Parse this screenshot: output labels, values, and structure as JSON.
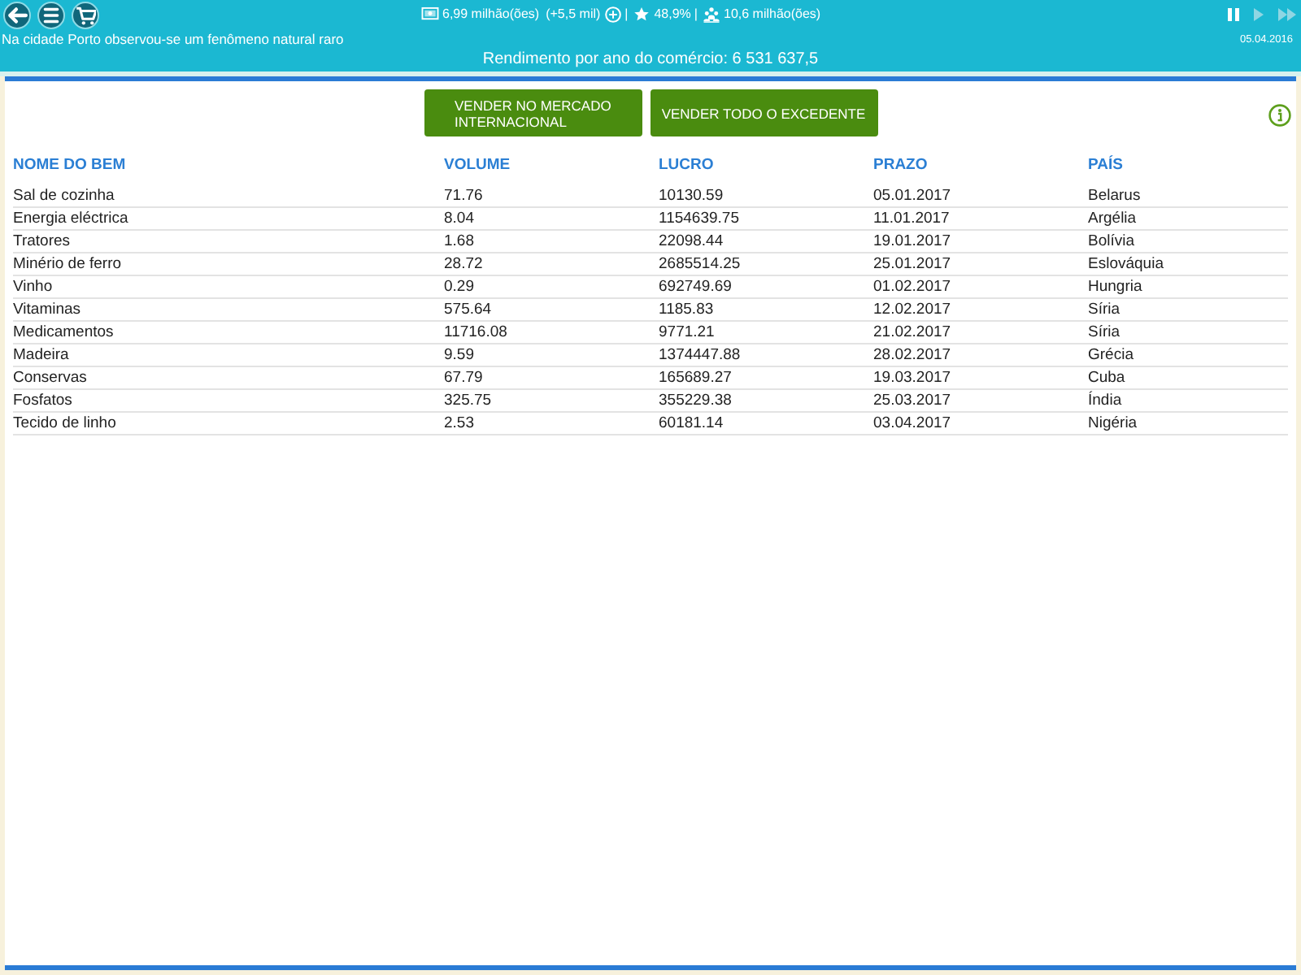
{
  "toolbar": {
    "stats": [
      {
        "kind": "treasury",
        "value": "6,99 milhão(ões)",
        "change": "(+5,5 mil)"
      },
      {
        "kind": "separator",
        "value": "|"
      },
      {
        "kind": "rating",
        "value": "48,9%"
      },
      {
        "kind": "separator",
        "value": "|"
      },
      {
        "kind": "population",
        "value": "10,6 milhão(ões)"
      }
    ],
    "speed_controls": [
      {
        "kind": "pause",
        "selected": true
      },
      {
        "kind": "play",
        "selected": false
      },
      {
        "kind": "fast_forward",
        "selected": false
      }
    ]
  },
  "news": "Na cidade Porto observou-se um fenômeno natural raro",
  "date": "05.04.2016",
  "trade_income": "Rendimento por ano do comércio: 6 531 637,5",
  "actions": [
    "VENDER NO MERCADO INTERNACIONAL",
    "VENDER TODO O EXCEDENTE"
  ],
  "table": {
    "columns": [
      "NOME DO BEM",
      "VOLUME",
      "LUCRO",
      "PRAZO",
      "PAÍS"
    ],
    "rows": [
      [
        "Sal de cozinha",
        "71.76",
        "10130.59",
        "05.01.2017",
        "Belarus"
      ],
      [
        "Energia eléctrica",
        "8.04",
        "1154639.75",
        "11.01.2017",
        "Argélia"
      ],
      [
        "Tratores",
        "1.68",
        "22098.44",
        "19.01.2017",
        "Bolívia"
      ],
      [
        "Minério de ferro",
        "28.72",
        "2685514.25",
        "25.01.2017",
        "Eslováquia"
      ],
      [
        "Vinho",
        "0.29",
        "692749.69",
        "01.02.2017",
        "Hungria"
      ],
      [
        "Vitaminas",
        "575.64",
        "1185.83",
        "12.02.2017",
        "Síria"
      ],
      [
        "Medicamentos",
        "11716.08",
        "9771.21",
        "21.02.2017",
        "Síria"
      ],
      [
        "Madeira",
        "9.59",
        "1374447.88",
        "28.02.2017",
        "Grécia"
      ],
      [
        "Conservas",
        "67.79",
        "165689.27",
        "19.03.2017",
        "Cuba"
      ],
      [
        "Fosfatos",
        "325.75",
        "355229.38",
        "25.03.2017",
        "Índia"
      ],
      [
        "Tecido de linho",
        "2.53",
        "60181.14",
        "03.04.2017",
        "Nigéria"
      ]
    ]
  }
}
